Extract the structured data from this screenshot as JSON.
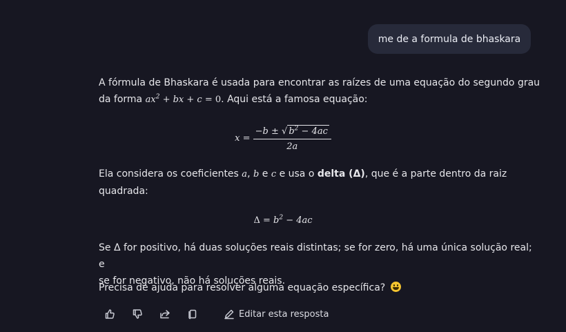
{
  "user_message": "me de a formula de bhaskara",
  "response": {
    "p1_text_a": "A fórmula de Bhaskara é usada para encontrar as raízes de uma equação do segundo grau",
    "p1_text_b": "da forma",
    "p1_math": "ax² + bx + c = 0",
    "p1_text_c": ". Aqui está a famosa equação:",
    "formula1_lhs": "x =",
    "formula1_num_a": "−b ± ",
    "formula1_num_sqrt": "b² − 4ac",
    "formula1_den": "2a",
    "p2_text_a": "Ela considera os coeficientes",
    "p2_a": "a",
    "p2_b": "b",
    "p2_e": "e",
    "p2_c": "c",
    "p2_text_b": "e usa o",
    "p2_bold": "delta (Δ)",
    "p2_text_c": ", que é a parte dentro da raiz",
    "p2_text_d": "quadrada:",
    "formula2": "Δ = b² − 4ac",
    "p3_line1": "Se Δ for positivo, há duas soluções reais distintas; se for zero, há uma única solução real; e",
    "p3_line2": "se for negativo, não há soluções reais.",
    "p4": "Precisa de ajuda para resolver alguma equação específica?",
    "p4_emoji": "smiling-face-emoji"
  },
  "toolbar": {
    "like_icon": "thumbs-up-icon",
    "dislike_icon": "thumbs-down-icon",
    "share_icon": "share-icon",
    "copy_icon": "copy-icon",
    "edit_label": "Editar esta resposta"
  }
}
